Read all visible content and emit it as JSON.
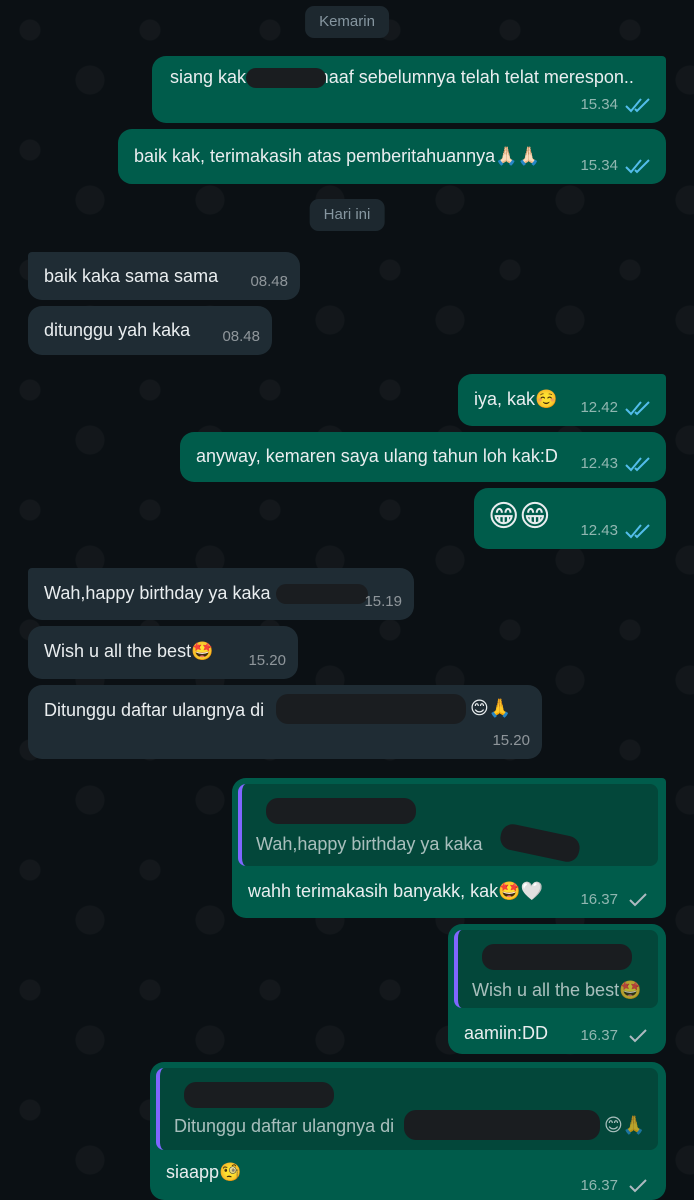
{
  "dates": {
    "yesterday": "Kemarin",
    "today": "Hari ini"
  },
  "messages": [
    {
      "id": "m1",
      "text": "siang kak                  maaf sebelumnya telah telat merespon..",
      "time": "15.34"
    },
    {
      "id": "m2",
      "text": "baik kak, terimakasih atas pemberitahuannya🙏🏻🙏🏻",
      "time": "15.34"
    },
    {
      "id": "m3",
      "text": "baik kaka sama sama",
      "time": "08.48"
    },
    {
      "id": "m4",
      "text": "ditunggu yah kaka",
      "time": "08.48"
    },
    {
      "id": "m5",
      "text": "iya, kak☺️",
      "time": "12.42"
    },
    {
      "id": "m6",
      "text": "anyway, kemaren saya ulang tahun loh kak:D",
      "time": "12.43"
    },
    {
      "id": "m7",
      "text": "😁😁",
      "time": "12.43"
    },
    {
      "id": "m8",
      "text": "Wah,happy birthday ya kaka",
      "time": "15.19"
    },
    {
      "id": "m9",
      "text": "Wish u all the best🤩",
      "time": "15.20"
    },
    {
      "id": "m10",
      "text": "Ditunggu daftar ulangnya di",
      "tail": "😊🙏",
      "time": "15.20"
    },
    {
      "id": "m11",
      "quote": "Wah,happy birthday ya kaka",
      "text": "wahh terimakasih banyakk, kak🤩🤍",
      "time": "16.37"
    },
    {
      "id": "m12",
      "quote": "Wish u all the best🤩",
      "text": "aamiin:DD",
      "time": "16.37"
    },
    {
      "id": "m13",
      "quote": "Ditunggu daftar ulangnya di",
      "quote_tail": "😊🙏",
      "text": "siaapp🧐",
      "time": "16.37"
    }
  ],
  "colors": {
    "outgoing": "#005c4b",
    "incoming": "#1f2c34",
    "read_tick": "#53bdeb",
    "sent_tick": "#8696a0"
  }
}
